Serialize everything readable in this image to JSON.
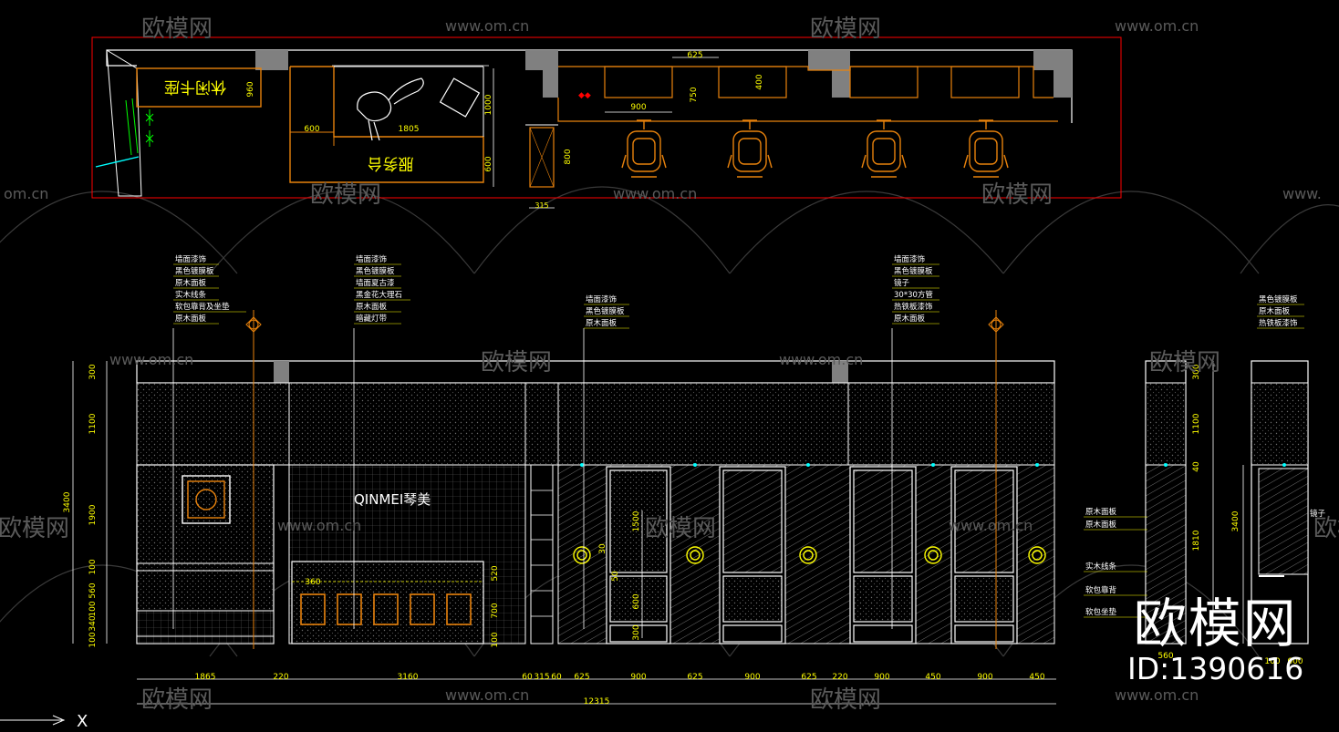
{
  "plan": {
    "room_left_label": "休闲卡座",
    "counter_label": "服务台",
    "dims": {
      "d960": "960",
      "d600a": "600",
      "d1805": "1805",
      "d1000": "1000",
      "d600b": "600",
      "d625": "625",
      "d900": "900",
      "d750": "750",
      "d400": "400",
      "d800": "800",
      "d315": "315"
    }
  },
  "callouts": {
    "a": [
      "墙面漆饰",
      "黑色镀膜板",
      "原木面板",
      "实木线条",
      "软包靠背及坐垫",
      "原木面板"
    ],
    "b": [
      "墙面漆饰",
      "黑色镀膜板",
      "墙面夏古漆",
      "黑金花大理石",
      "原木面板",
      "暗藏灯带"
    ],
    "c": [
      "墙面漆饰",
      "黑色镀膜板",
      "原木面板"
    ],
    "d": [
      "墙面漆饰",
      "黑色镀膜板",
      "镜子",
      "30*30方管",
      "热铁板漆饰",
      "原木面板"
    ],
    "e": [
      "黑色镀膜板",
      "原木面板",
      "热铁板漆饰"
    ]
  },
  "elevation": {
    "logo_text": "QINMEI琴美",
    "left_dims": [
      "300",
      "1100",
      "1900",
      "100",
      "560",
      "100",
      "340",
      "100",
      "3400"
    ],
    "right_dims": [
      "520",
      "700",
      "100"
    ],
    "mirror_dims": [
      "1500",
      "30",
      "50",
      "600",
      "300"
    ],
    "box_dim": "360",
    "bottom_dims": [
      "1865",
      "220",
      "3160",
      "60",
      "315",
      "60",
      "625",
      "900",
      "625",
      "900",
      "625",
      "220",
      "900",
      "450",
      "900",
      "450"
    ],
    "total_dim": "12315"
  },
  "side": {
    "labels": [
      "原木面板",
      "原木面板",
      "实木线条",
      "软包靠背",
      "软包坐垫"
    ],
    "right_label": "镜子",
    "dims": [
      "300",
      "1100",
      "40",
      "1810",
      "3400"
    ],
    "bottom_dims": [
      "560",
      "100",
      "600"
    ]
  },
  "watermarks": {
    "brand": "欧模网",
    "site": "www.om.cn",
    "om": "om.cn",
    "www": "www.",
    "partial": "欧模网"
  },
  "branding": {
    "title": "欧模网",
    "id_text": "ID:1390616"
  },
  "axis": {
    "x_label": "X"
  },
  "colors": {
    "background": "#000000",
    "white_line": "#ffffff",
    "orange": "#e8820c",
    "yellow": "#ffff00",
    "red": "#ff0000",
    "cyan": "#00ffff",
    "green": "#00ff00",
    "gray": "#808080",
    "watermark": "#5a5a5a"
  }
}
